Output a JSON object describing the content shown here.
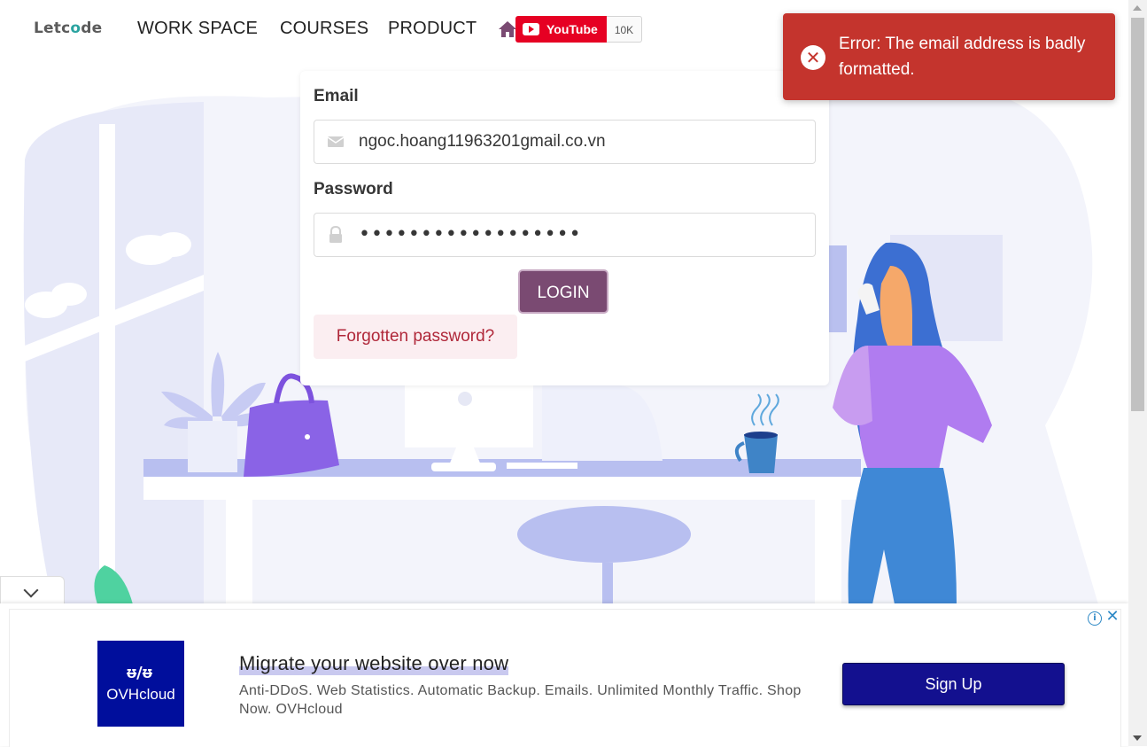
{
  "navbar": {
    "logo_part1": "Letc",
    "logo_part2": "o",
    "logo_part3": "de",
    "items": [
      {
        "label": "WORK SPACE"
      },
      {
        "label": "COURSES"
      },
      {
        "label": "PRODUCT"
      }
    ],
    "youtube_label": "YouTube",
    "youtube_count": "10K"
  },
  "login": {
    "email_label": "Email",
    "email_value": "ngoc.hoang11963201gmail.co.vn",
    "password_label": "Password",
    "password_value": "••••••••••••••••••",
    "login_button": "LOGIN",
    "forgot_link": "Forgotten password?"
  },
  "toast": {
    "message": "Error: The email address is badly formatted.",
    "icon": "close-circle-icon"
  },
  "ad": {
    "brand": "OVHcloud",
    "headline": "Migrate your website over now",
    "description": "Anti-DDoS. Web Statistics. Automatic Backup. Emails. Unlimited Monthly Traffic. Shop Now. OVHcloud",
    "cta": "Sign Up"
  },
  "colors": {
    "primary": "#7a4a72",
    "error": "#c4342d",
    "forgot_bg": "#fbeef1",
    "forgot_text": "#b0283a",
    "ad_cta": "#13108f",
    "ad_logo": "#000e9c"
  }
}
